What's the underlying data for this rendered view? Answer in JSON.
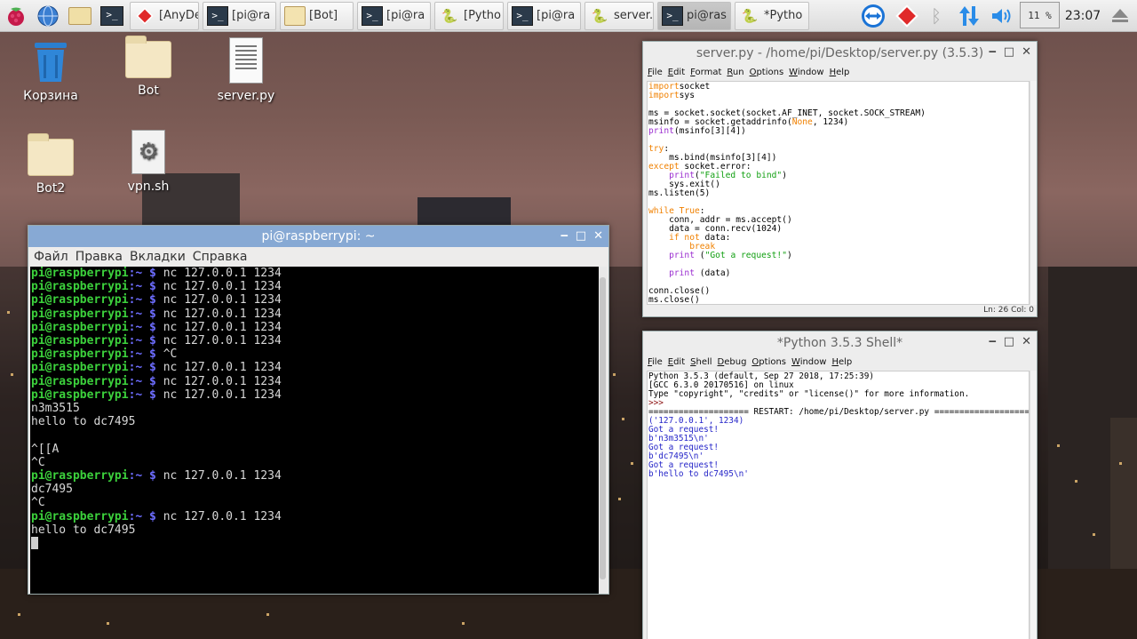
{
  "taskbar": {
    "tasks": [
      {
        "label": "[AnyDe",
        "icon": "anydesk-icon"
      },
      {
        "label": "[pi@ra",
        "icon": "terminal-icon"
      },
      {
        "label": "[Bot]",
        "icon": "folder-icon"
      },
      {
        "label": "[pi@ra",
        "icon": "terminal-icon"
      },
      {
        "label": "[Pytho",
        "icon": "python-icon"
      },
      {
        "label": "[pi@ra",
        "icon": "terminal-icon"
      },
      {
        "label": "server.",
        "icon": "python-icon"
      },
      {
        "label": "pi@ras",
        "icon": "terminal-icon"
      },
      {
        "label": "*Pytho",
        "icon": "python-icon"
      }
    ],
    "cpu": "11 %",
    "clock": "23:07",
    "colors": {
      "anydesk": "#e02a2a",
      "teamviewer": "#1a73d6",
      "updown": "#2a8ce8"
    }
  },
  "desktop": {
    "icons": [
      {
        "label": "Корзина",
        "icon": "trash-icon"
      },
      {
        "label": "Bot",
        "icon": "folder-icon"
      },
      {
        "label": "server.py",
        "icon": "text-file-icon"
      },
      {
        "label": "Bot2",
        "icon": "folder-icon"
      },
      {
        "label": "vpn.sh",
        "icon": "script-gear-icon"
      }
    ]
  },
  "terminal": {
    "title": "pi@raspberrypi: ~",
    "menu": [
      "Файл",
      "Правка",
      "Вкладки",
      "Справка"
    ],
    "prompt_user": "pi@raspberrypi",
    "prompt_path": ":~ $ ",
    "lines": [
      {
        "prompt": true,
        "cmd": "nc 127.0.0.1 1234"
      },
      {
        "prompt": true,
        "cmd": "nc 127.0.0.1 1234"
      },
      {
        "prompt": true,
        "cmd": "nc 127.0.0.1 1234"
      },
      {
        "prompt": true,
        "cmd": "nc 127.0.0.1 1234"
      },
      {
        "prompt": true,
        "cmd": "nc 127.0.0.1 1234"
      },
      {
        "prompt": true,
        "cmd": "nc 127.0.0.1 1234"
      },
      {
        "prompt": true,
        "cmd": "^C"
      },
      {
        "prompt": true,
        "cmd": "nc 127.0.0.1 1234"
      },
      {
        "prompt": true,
        "cmd": "nc 127.0.0.1 1234"
      },
      {
        "prompt": true,
        "cmd": "nc 127.0.0.1 1234"
      },
      {
        "prompt": false,
        "text": "n3m3515"
      },
      {
        "prompt": false,
        "text": "hello to dc7495"
      },
      {
        "prompt": false,
        "text": ""
      },
      {
        "prompt": false,
        "text": "^[[A"
      },
      {
        "prompt": false,
        "text": "^C"
      },
      {
        "prompt": true,
        "cmd": "nc 127.0.0.1 1234"
      },
      {
        "prompt": false,
        "text": "dc7495"
      },
      {
        "prompt": false,
        "text": "^C"
      },
      {
        "prompt": true,
        "cmd": "nc 127.0.0.1 1234"
      },
      {
        "prompt": false,
        "text": "hello to dc7495"
      }
    ]
  },
  "editor": {
    "title": "server.py - /home/pi/Desktop/server.py (3.5.3)",
    "menu": [
      "File",
      "Edit",
      "Format",
      "Run",
      "Options",
      "Window",
      "Help"
    ],
    "lines": [
      [
        [
          "kw",
          "import"
        ],
        [
          "",
          "socket"
        ]
      ],
      [
        [
          "kw",
          "import"
        ],
        [
          "",
          "sys"
        ]
      ],
      [],
      [
        [
          "",
          "ms = socket.socket(socket.AF_INET, socket.SOCK_STREAM)"
        ]
      ],
      [
        [
          "",
          "msinfo = socket.getaddrinfo("
        ],
        [
          "kw",
          "None"
        ],
        [
          "",
          ", 1234)"
        ]
      ],
      [
        [
          "bi",
          "print"
        ],
        [
          "",
          "(msinfo[3][4])"
        ]
      ],
      [],
      [
        [
          "kw",
          "try"
        ],
        [
          "",
          ":"
        ]
      ],
      [
        [
          "",
          "    ms.bind(msinfo[3][4])"
        ]
      ],
      [
        [
          "kw",
          "except"
        ],
        [
          "",
          " socket.error:"
        ]
      ],
      [
        [
          "",
          "    "
        ],
        [
          "bi",
          "print"
        ],
        [
          "",
          "("
        ],
        [
          "st",
          "\"Failed to bind\""
        ],
        [
          "",
          ")"
        ]
      ],
      [
        [
          "",
          "    sys.exit()"
        ]
      ],
      [
        [
          "",
          "ms.listen(5)"
        ]
      ],
      [],
      [
        [
          "kw",
          "while"
        ],
        [
          "",
          " "
        ],
        [
          "kw",
          "True"
        ],
        [
          "",
          ":"
        ]
      ],
      [
        [
          "",
          "    conn, addr = ms.accept()"
        ]
      ],
      [
        [
          "",
          "    data = conn.recv(1024)"
        ]
      ],
      [
        [
          "",
          "    "
        ],
        [
          "kw",
          "if not"
        ],
        [
          "",
          " data:"
        ]
      ],
      [
        [
          "",
          "        "
        ],
        [
          "kw",
          "break"
        ]
      ],
      [
        [
          "",
          "    "
        ],
        [
          "bi",
          "print"
        ],
        [
          "",
          " ("
        ],
        [
          "st",
          "\"Got a request!\""
        ],
        [
          "",
          ")"
        ]
      ],
      [],
      [
        [
          "",
          "    "
        ],
        [
          "bi",
          "print"
        ],
        [
          "",
          " (data)"
        ]
      ],
      [],
      [
        [
          "",
          "conn.close()"
        ]
      ],
      [
        [
          "",
          "ms.close()"
        ]
      ]
    ],
    "status": "Ln: 26  Col: 0"
  },
  "shell": {
    "title": "*Python 3.5.3 Shell*",
    "menu": [
      "File",
      "Edit",
      "Shell",
      "Debug",
      "Options",
      "Window",
      "Help"
    ],
    "lines": [
      [
        [
          "",
          "Python 3.5.3 (default, Sep 27 2018, 17:25:39)"
        ]
      ],
      [
        [
          "",
          "[GCC 6.3.0 20170516] on linux"
        ]
      ],
      [
        [
          "",
          "Type \"copyright\", \"credits\" or \"license()\" for more information."
        ]
      ],
      [
        [
          "prm",
          ">>> "
        ]
      ],
      [
        [
          "",
          "==================== RESTART: /home/pi/Desktop/server.py ===================="
        ]
      ],
      [
        [
          "out",
          "('127.0.0.1', 1234)"
        ]
      ],
      [
        [
          "out",
          "Got a request!"
        ]
      ],
      [
        [
          "out",
          "b'n3m3515\\n'"
        ]
      ],
      [
        [
          "out",
          "Got a request!"
        ]
      ],
      [
        [
          "out",
          "b'dc7495\\n'"
        ]
      ],
      [
        [
          "out",
          "Got a request!"
        ]
      ],
      [
        [
          "out",
          "b'hello to dc7495\\n'"
        ]
      ]
    ]
  }
}
